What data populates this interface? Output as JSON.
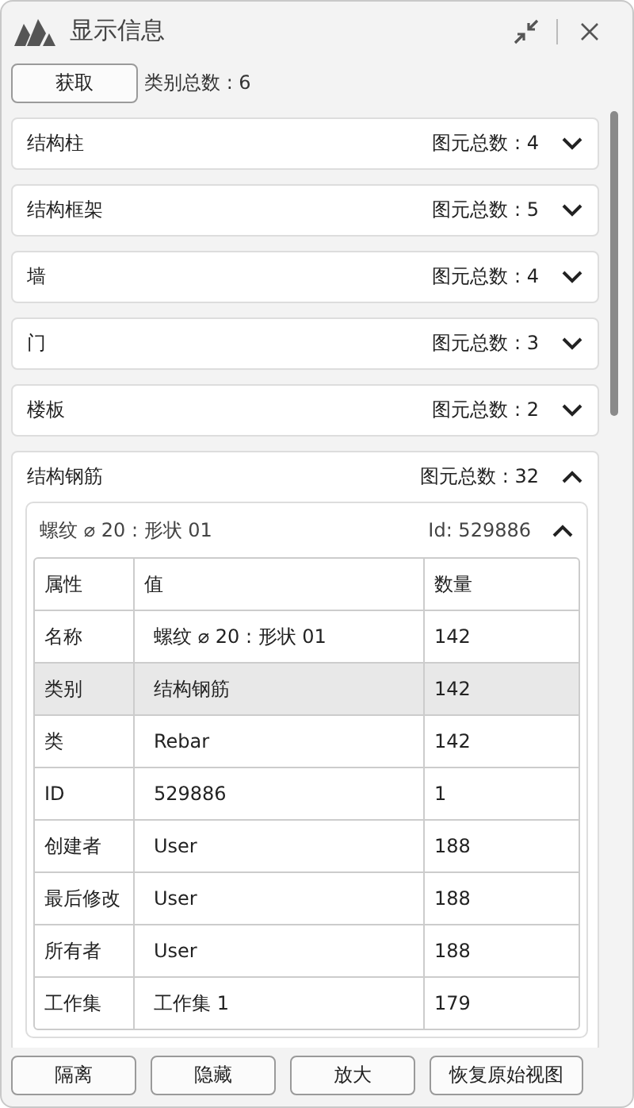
{
  "window": {
    "title": "显示信息"
  },
  "toolbar": {
    "fetch_button": "获取",
    "category_count": "类别总数 : 6"
  },
  "categories": [
    {
      "name": "结构柱",
      "count": "图元总数 : 4",
      "expanded": false
    },
    {
      "name": "结构框架",
      "count": "图元总数 : 5",
      "expanded": false
    },
    {
      "name": "墙",
      "count": "图元总数 : 4",
      "expanded": false
    },
    {
      "name": "门",
      "count": "图元总数 : 3",
      "expanded": false
    },
    {
      "name": "楼板",
      "count": "图元总数 : 2",
      "expanded": false
    },
    {
      "name": "结构钢筋",
      "count": "图元总数 : 32",
      "expanded": true,
      "elements": [
        {
          "name": "螺纹 ⌀ 20 : 形状 01",
          "id": "Id: 529886",
          "expanded": true,
          "table": {
            "columns": [
              "属性",
              "值",
              "数量"
            ],
            "rows": [
              {
                "cells": [
                  "名称",
                  "螺纹 ⌀ 20 : 形状 01",
                  "142"
                ],
                "selected": false
              },
              {
                "cells": [
                  "类别",
                  "结构钢筋",
                  "142"
                ],
                "selected": true
              },
              {
                "cells": [
                  "类",
                  "Rebar",
                  "142"
                ],
                "selected": false
              },
              {
                "cells": [
                  "ID",
                  "529886",
                  "1"
                ],
                "selected": false
              },
              {
                "cells": [
                  "创建者",
                  "User",
                  "188"
                ],
                "selected": false
              },
              {
                "cells": [
                  "最后修改",
                  "User",
                  "188"
                ],
                "selected": false
              },
              {
                "cells": [
                  "所有者",
                  "User",
                  "188"
                ],
                "selected": false
              },
              {
                "cells": [
                  "工作集",
                  "工作集 1",
                  "179"
                ],
                "selected": false
              }
            ]
          }
        }
      ]
    }
  ],
  "footer_buttons": [
    "隔离",
    "隐藏",
    "放大",
    "恢复原始视图"
  ]
}
